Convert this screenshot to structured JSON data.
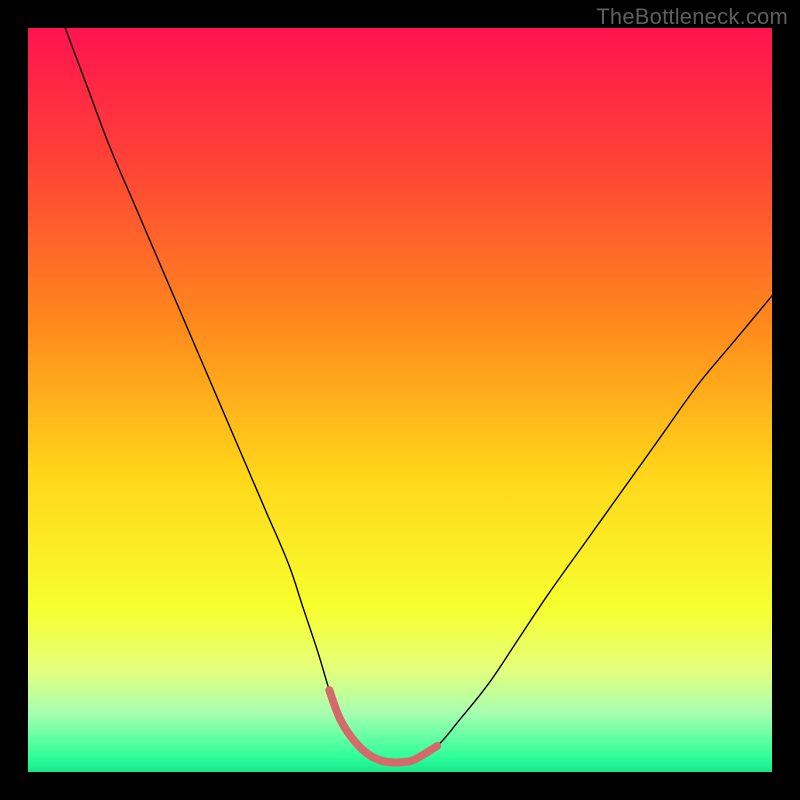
{
  "watermark": "TheBottleneck.com",
  "chart_data": {
    "type": "line",
    "title": "",
    "xlabel": "",
    "ylabel": "",
    "xlim": [
      0,
      100
    ],
    "ylim": [
      0,
      100
    ],
    "grid": false,
    "legend": false,
    "axes_visible": false,
    "background_gradient": {
      "direction": "vertical",
      "stops": [
        {
          "offset": 0.0,
          "color": "#ff1450"
        },
        {
          "offset": 0.18,
          "color": "#ff4236"
        },
        {
          "offset": 0.4,
          "color": "#ff8a1c"
        },
        {
          "offset": 0.6,
          "color": "#ffd61a"
        },
        {
          "offset": 0.78,
          "color": "#f7ff2e"
        },
        {
          "offset": 0.86,
          "color": "#e6ff7a"
        },
        {
          "offset": 0.92,
          "color": "#a8ffb0"
        },
        {
          "offset": 0.98,
          "color": "#2eff9a"
        },
        {
          "offset": 1.0,
          "color": "#17e88c"
        }
      ]
    },
    "series": [
      {
        "name": "bottleneck-curve",
        "stroke": "#000000",
        "stroke_width": 1.4,
        "x": [
          5,
          8,
          11,
          14,
          17,
          20,
          23,
          26,
          29,
          32,
          35,
          37,
          39,
          40.5,
          42,
          44,
          46,
          48,
          50,
          52,
          55,
          58,
          62,
          66,
          70,
          75,
          80,
          85,
          90,
          95,
          100
        ],
        "y": [
          100,
          92,
          84,
          77,
          70,
          63,
          56,
          49,
          42,
          35,
          28,
          22,
          16,
          11,
          7,
          4,
          2.2,
          1.4,
          1.3,
          1.7,
          3.5,
          7,
          12,
          18,
          24,
          31,
          38,
          45,
          52,
          58,
          64
        ]
      },
      {
        "name": "optimal-zone-highlight",
        "stroke": "#d46a6a",
        "stroke_width": 8,
        "x": [
          40.5,
          42,
          44,
          46,
          48,
          50,
          52,
          55
        ],
        "y": [
          11,
          7,
          4,
          2.2,
          1.4,
          1.3,
          1.7,
          3.5
        ]
      }
    ],
    "annotations": []
  }
}
